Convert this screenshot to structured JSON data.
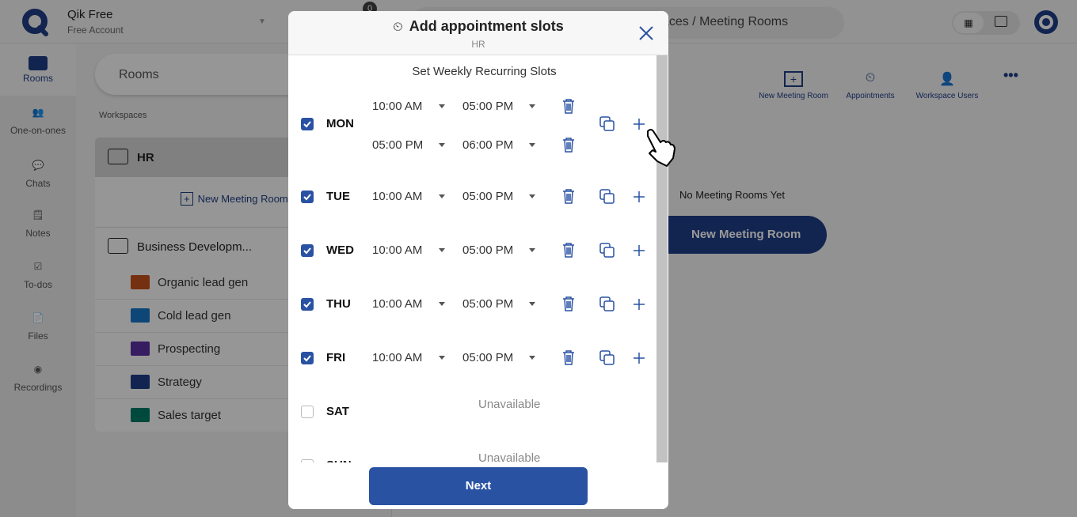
{
  "app": {
    "name": "Qik Free",
    "account": "Free Account",
    "badge": "0"
  },
  "nav": [
    {
      "label": "Rooms",
      "active": true
    },
    {
      "label": "One-on-ones"
    },
    {
      "label": "Chats"
    },
    {
      "label": "Notes"
    },
    {
      "label": "To-dos"
    },
    {
      "label": "Files"
    },
    {
      "label": "Recordings"
    }
  ],
  "rooms_panel": {
    "search_placeholder": "Rooms",
    "section_label": "Workspaces",
    "workspaces": [
      {
        "name": "HR",
        "new_room": "New Meeting Room"
      },
      {
        "name": "Business Developm..."
      }
    ],
    "rooms": [
      {
        "name": "Organic lead gen",
        "color": "#c4501a"
      },
      {
        "name": "Cold lead gen",
        "color": "#1676c6"
      },
      {
        "name": "Prospecting",
        "color": "#5a30a0"
      },
      {
        "name": "Strategy",
        "color": "#1f3d85"
      },
      {
        "name": "Sales target",
        "color": "#007a66"
      }
    ]
  },
  "header": {
    "breadcrumb": "Workspaces / Meeting Rooms"
  },
  "main": {
    "actions": [
      "New Meeting Room",
      "Appointments",
      "Workspace Users"
    ],
    "empty_text": "No Meeting Rooms Yet",
    "new_room_button": "New Meeting Room"
  },
  "modal": {
    "title": "Add appointment slots",
    "subtitle": "HR",
    "section": "Set Weekly Recurring Slots",
    "next": "Next",
    "unavailable": "Unavailable",
    "days": [
      {
        "day": "MON",
        "checked": true,
        "slots": [
          [
            "10:00 AM",
            "05:00 PM"
          ],
          [
            "05:00 PM",
            "06:00 PM"
          ]
        ]
      },
      {
        "day": "TUE",
        "checked": true,
        "slots": [
          [
            "10:00 AM",
            "05:00 PM"
          ]
        ]
      },
      {
        "day": "WED",
        "checked": true,
        "slots": [
          [
            "10:00 AM",
            "05:00 PM"
          ]
        ]
      },
      {
        "day": "THU",
        "checked": true,
        "slots": [
          [
            "10:00 AM",
            "05:00 PM"
          ]
        ]
      },
      {
        "day": "FRI",
        "checked": true,
        "slots": [
          [
            "10:00 AM",
            "05:00 PM"
          ]
        ]
      },
      {
        "day": "SAT",
        "checked": false,
        "slots": []
      },
      {
        "day": "SUN",
        "checked": false,
        "slots": []
      }
    ]
  },
  "colors": {
    "brand": "#1f3d85",
    "button": "#2a52a3"
  }
}
